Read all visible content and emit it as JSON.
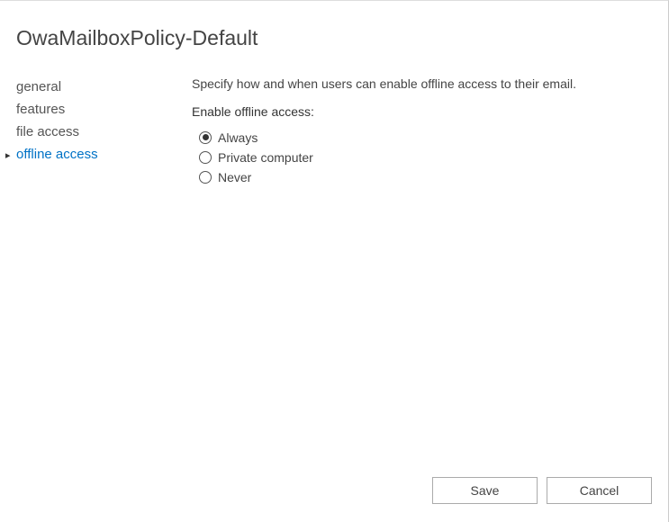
{
  "title": "OwaMailboxPolicy-Default",
  "sidebar": {
    "items": [
      {
        "label": "general",
        "active": false
      },
      {
        "label": "features",
        "active": false
      },
      {
        "label": "file access",
        "active": false
      },
      {
        "label": "offline access",
        "active": true
      }
    ]
  },
  "main": {
    "description": "Specify how and when users can enable offline access to their email.",
    "field_label": "Enable offline access:",
    "options": [
      {
        "label": "Always",
        "selected": true
      },
      {
        "label": "Private computer",
        "selected": false
      },
      {
        "label": "Never",
        "selected": false
      }
    ]
  },
  "footer": {
    "save": "Save",
    "cancel": "Cancel"
  }
}
